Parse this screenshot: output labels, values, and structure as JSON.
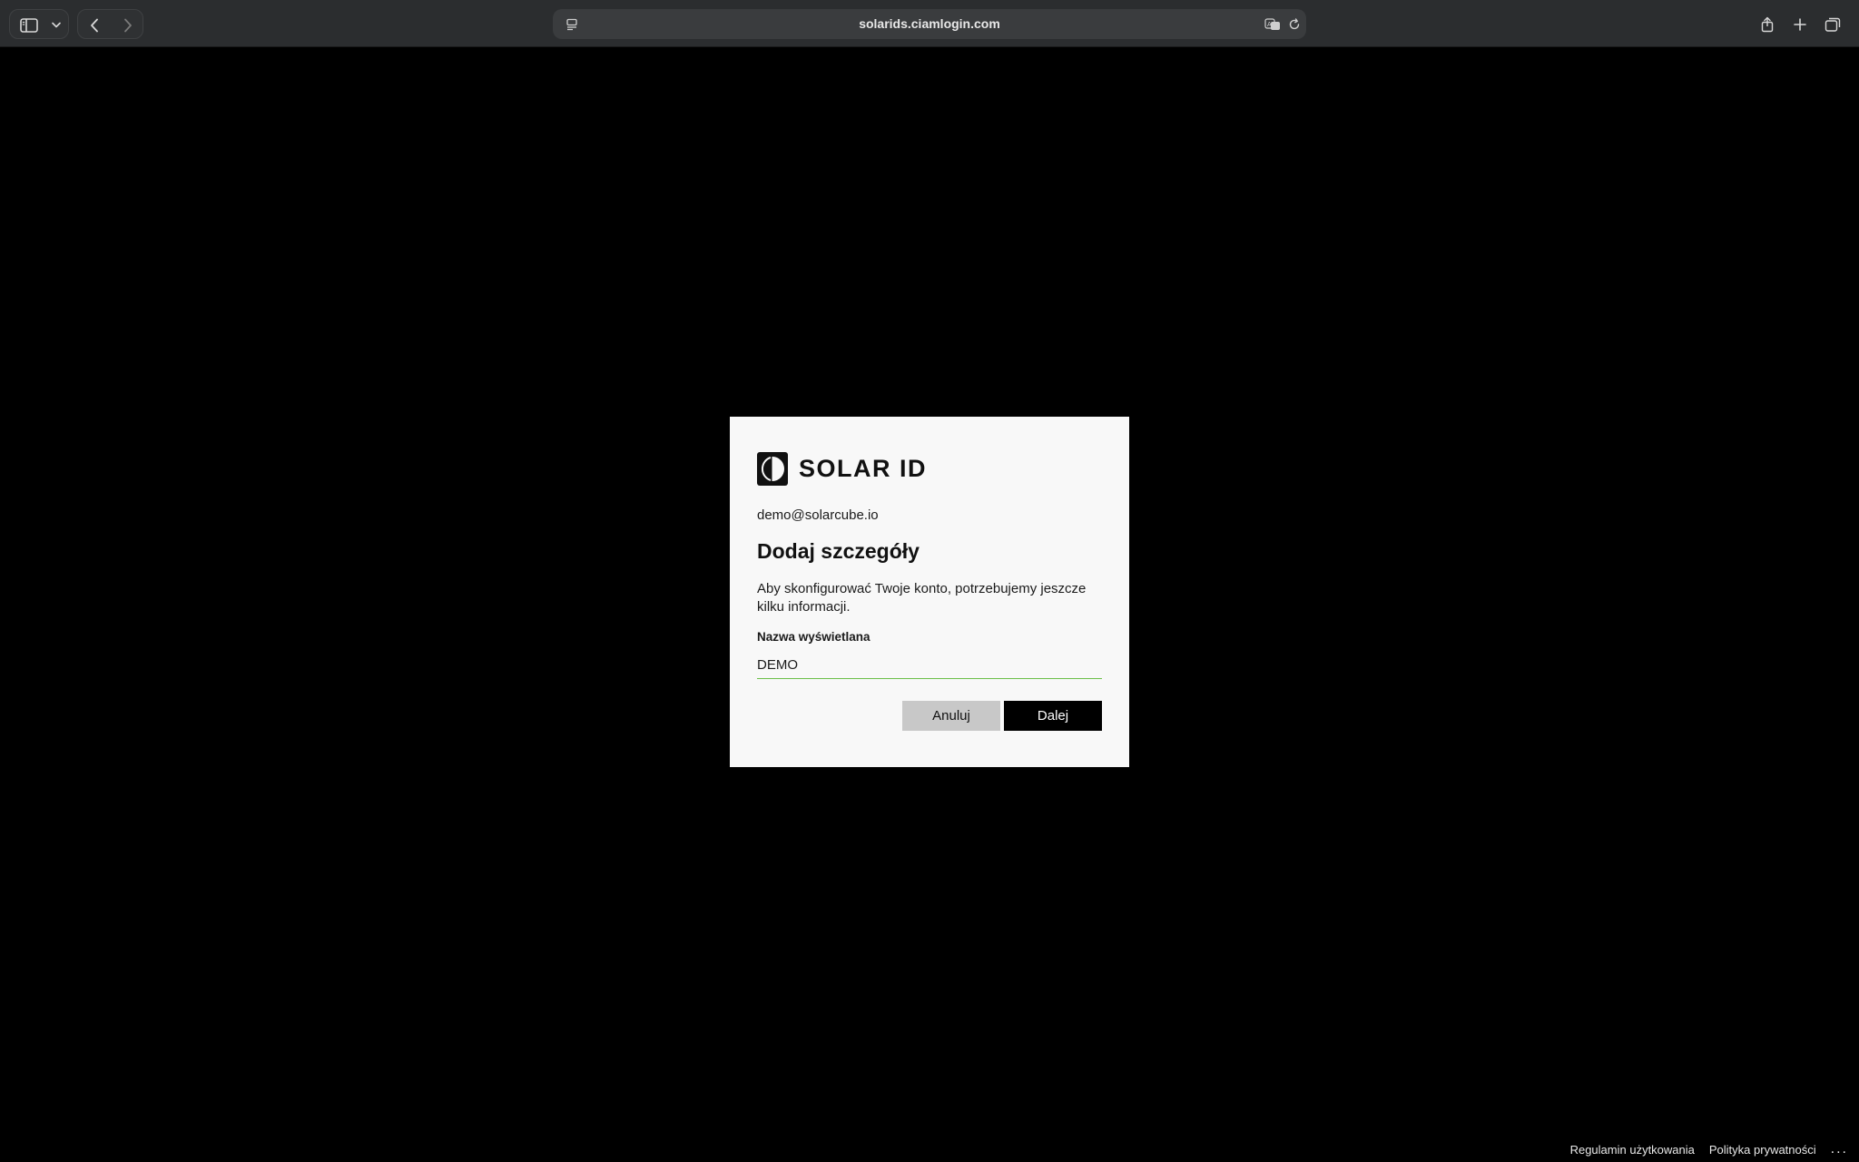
{
  "browser": {
    "url": "solarids.ciamlogin.com",
    "icons": {
      "sidebar": "sidebar-icon",
      "sidebar_menu": "chevron-down-icon",
      "back": "chevron-left-icon",
      "forward": "chevron-right-icon",
      "page_menu": "page-menu-icon",
      "translate": "translate-icon",
      "reload": "reload-icon",
      "share": "share-icon",
      "new_tab": "plus-icon",
      "tab_overview": "tabs-icon"
    }
  },
  "dialog": {
    "logo_text": "SOLAR ID",
    "email": "demo@solarcube.io",
    "heading": "Dodaj szczegóły",
    "description": "Aby skonfigurować Twoje konto, potrzebujemy jeszcze kilku informacji.",
    "field_label": "Nazwa wyświetlana",
    "field_value": "DEMO",
    "cancel_label": "Anuluj",
    "next_label": "Dalej"
  },
  "footer": {
    "terms": "Regulamin użytkowania",
    "privacy": "Polityka prywatności",
    "more": "..."
  },
  "colors": {
    "page_background": "#000000",
    "dialog_background": "#f8f8f8",
    "input_underline": "#6cc04a",
    "primary_button": "#000000",
    "secondary_button": "#c8c8c8"
  }
}
